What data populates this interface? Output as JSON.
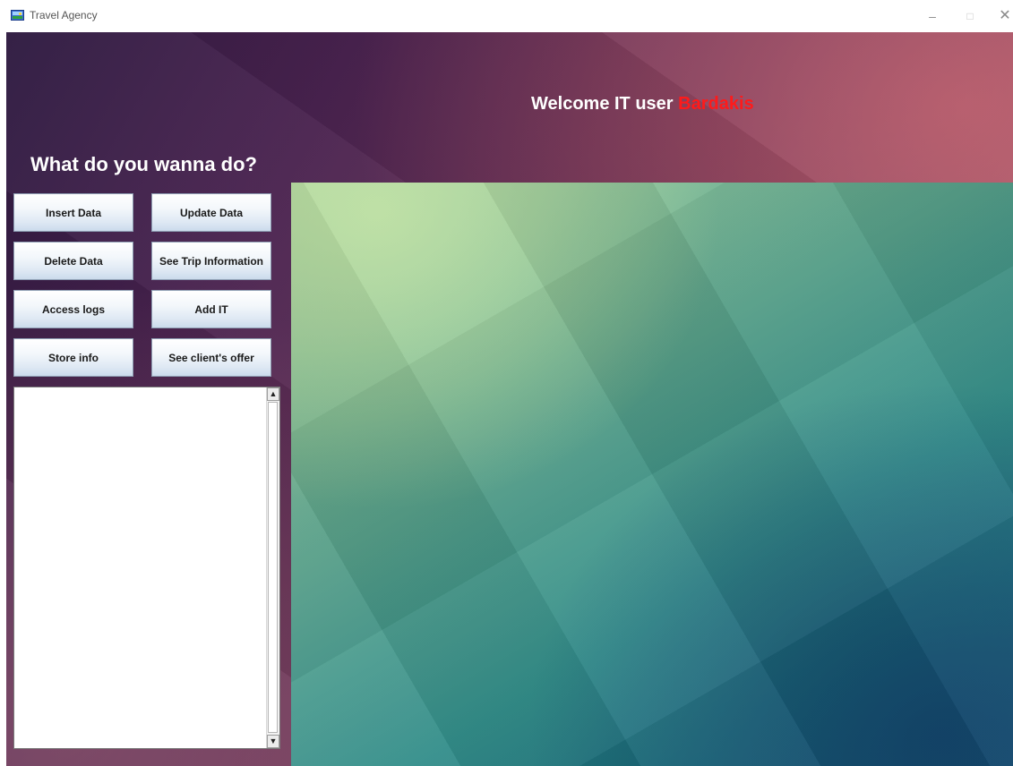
{
  "window": {
    "title": "Travel Agency",
    "minimize_glyph": "–",
    "maximize_glyph": "□",
    "close_glyph": "✕"
  },
  "header": {
    "welcome_prefix": "Welcome IT user ",
    "username": "Bardakis",
    "username_color": "#ff1a1a"
  },
  "menu": {
    "prompt": "What do you wanna do?",
    "buttons": [
      {
        "label": "Insert Data"
      },
      {
        "label": "Update Data"
      },
      {
        "label": "Delete Data"
      },
      {
        "label": "See Trip Information"
      },
      {
        "label": "Access logs"
      },
      {
        "label": "Add IT"
      },
      {
        "label": "Store info"
      },
      {
        "label": "See client's offer"
      }
    ]
  },
  "output": {
    "value": "",
    "scroll_up_glyph": "▲",
    "scroll_down_glyph": "▼"
  }
}
